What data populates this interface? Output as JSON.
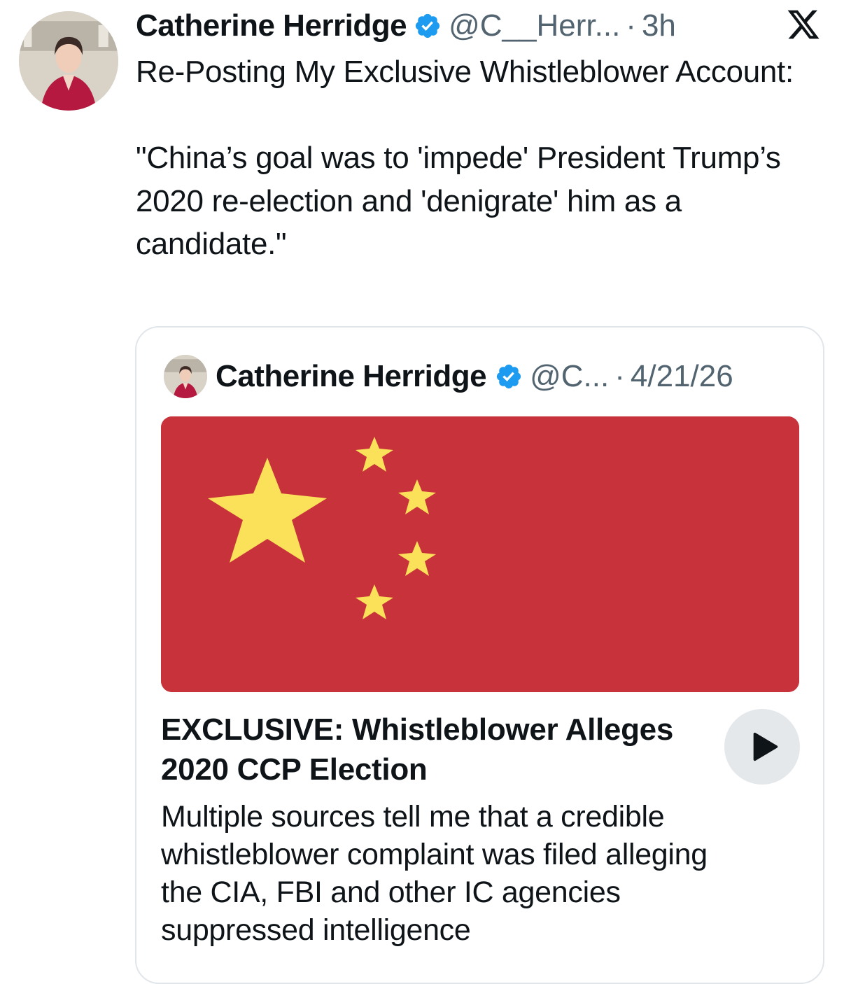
{
  "tweet": {
    "author_name": "Catherine Herridge",
    "handle": "@C__Herr...",
    "separator": "·",
    "time": "3h",
    "text_lines": [
      "Re-Posting My Exclusive Whistleblower Account:",
      "",
      "\"China’s goal was to 'impede' President Trump’s 2020 re-election and 'denigrate' him as a candidate.\""
    ]
  },
  "quoted_tweet": {
    "author_name": "Catherine Herridge",
    "handle": "@C...",
    "separator": "·",
    "date": "4/21/26",
    "media_icon": "china-flag-image",
    "card": {
      "title": "EXCLUSIVE: Whistleblower Alleges 2020 CCP Election",
      "description": "Multiple sources tell me that a credible whistleblower complaint was filed alleging the CIA, FBI and other IC agencies suppressed intelligence"
    }
  },
  "icons": {
    "verified": "verified-badge-icon",
    "brand": "x-logo-icon",
    "play": "play-icon"
  },
  "colors": {
    "verified_blue": "#1d9bf0",
    "secondary_text": "#536471",
    "flag_red": "#c8323a",
    "flag_yellow": "#fbe05a"
  }
}
